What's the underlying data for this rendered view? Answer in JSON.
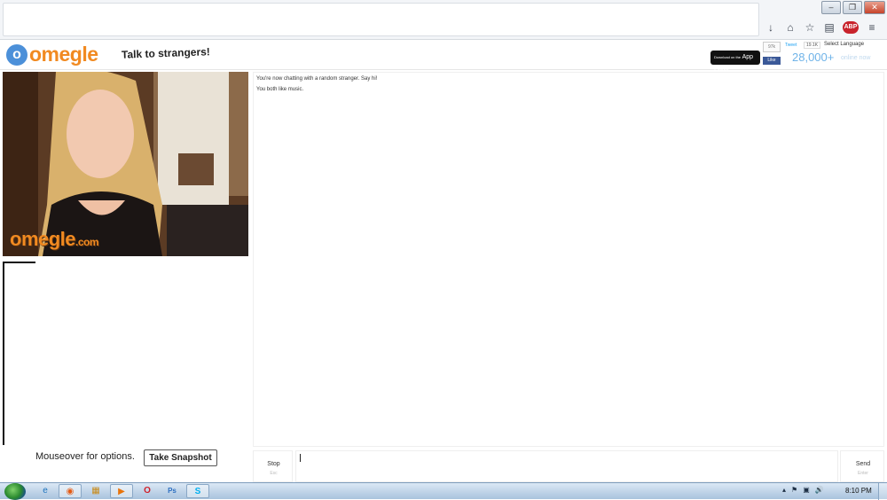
{
  "browser": {
    "window_controls": {
      "minimize": "–",
      "maximize": "❐",
      "close": "✕"
    },
    "toolbar": {
      "download_icon": "↓",
      "home_icon": "⌂",
      "bookmark_icon": "☆",
      "reader_icon": "▤",
      "adblock_label": "ABP",
      "menu_icon": "≡"
    }
  },
  "header": {
    "logo_mark": "o",
    "logo_text": "omegle",
    "tagline": "Talk to strangers!",
    "app_store_small": "Download on the",
    "app_store_label": "App Store",
    "social_count": "97k",
    "fb_like": "Like",
    "tweet_label": "Tweet",
    "tweet_count": "19.1K",
    "language": "Select Language",
    "online_count": "28,000+",
    "online_label": "online now"
  },
  "video": {
    "watermark_main": "omegle",
    "watermark_suffix": ".com"
  },
  "chat": {
    "lines": [
      "You're now chatting with a random stranger. Say hi!",
      "You both like music."
    ]
  },
  "controls": {
    "video_options": "Mouseover for options.",
    "snapshot_button": "Take Snapshot",
    "stop_label": "Stop",
    "stop_hint": "Esc",
    "send_label": "Send",
    "send_hint": "Enter"
  },
  "taskbar": {
    "apps": [
      "e",
      "◉",
      "▦",
      "▶",
      "O",
      "Ps",
      "S"
    ],
    "tray_icons": [
      "▴",
      "⚑",
      "▣",
      "🔊"
    ],
    "clock": "8:10 PM"
  }
}
